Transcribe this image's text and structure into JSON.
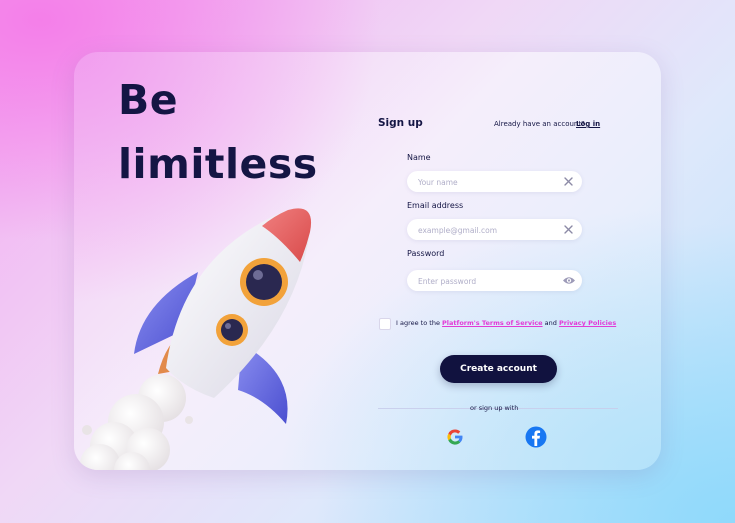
{
  "hero": {
    "line1": "Be",
    "line2": "limitless"
  },
  "form": {
    "title": "Sign up",
    "have_account": "Already have an account?",
    "login_link": "Log in",
    "name_label": "Name",
    "name_placeholder": "Your name",
    "email_label": "Email address",
    "email_placeholder": "example@gmail.com",
    "password_label": "Password",
    "password_placeholder": "Enter password",
    "agree_prefix": "I agree to the",
    "terms_link": "Platform's Terms of Service",
    "and_text": "and",
    "privacy_link": "Privacy Policies",
    "submit_label": "Create account",
    "or_text": "or sign up with"
  },
  "social": [
    "google-icon",
    "facebook-icon"
  ],
  "colors": {
    "navy": "#141544",
    "button": "#11123f",
    "link_pink": "#e23bd6",
    "facebook": "#1877f2"
  }
}
